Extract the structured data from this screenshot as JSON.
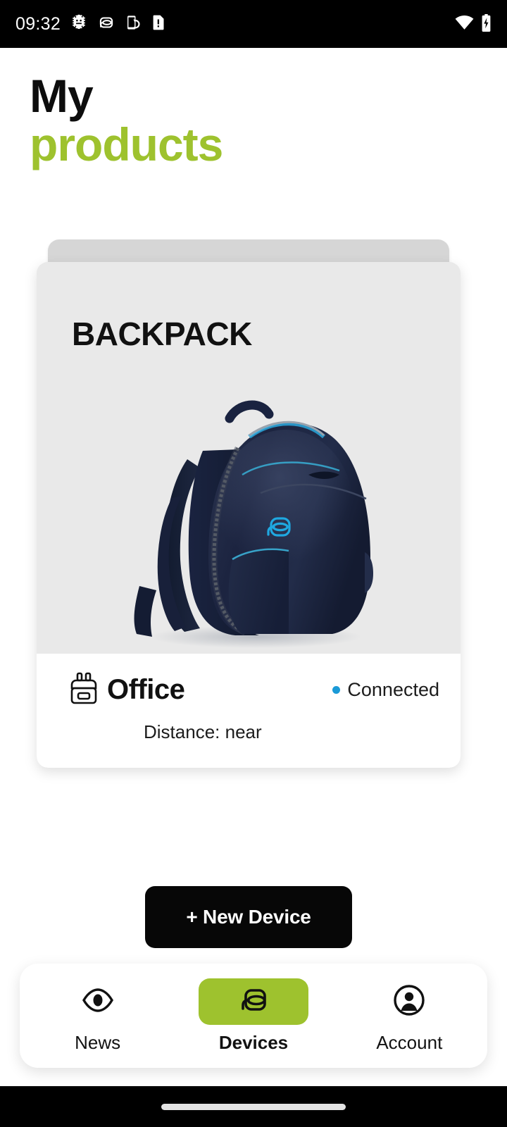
{
  "status_bar": {
    "time": "09:32",
    "left_icons": [
      "bug-gear-icon",
      "backpack-app-icon",
      "phone-sync-icon",
      "sd-card-alert-icon"
    ],
    "right_icons": [
      "wifi-icon",
      "battery-charging-icon"
    ],
    "background": "#000000",
    "foreground": "#ffffff"
  },
  "header": {
    "title_line1": "My",
    "title_line2": "products",
    "accent_color": "#9ec22e"
  },
  "product_card": {
    "category": "BACKPACK",
    "image_alt": "navy-blue-leather-backpack",
    "device_name": "Office",
    "device_icon": "backpack-icon",
    "status_label": "Connected",
    "status_color": "#1a9ad7",
    "distance_label": "Distance: near",
    "card_background": "#e9e9e9",
    "stack_background": "#d6d6d6",
    "footer_background": "#ffffff"
  },
  "actions": {
    "new_device_label": "+ New Device",
    "new_device_background": "#070707"
  },
  "bottom_nav": {
    "active_background": "#9ec22e",
    "items": [
      {
        "label": "News",
        "icon": "eye-icon",
        "active": false
      },
      {
        "label": "Devices",
        "icon": "bag-logo-icon",
        "active": true
      },
      {
        "label": "Account",
        "icon": "account-circle-icon",
        "active": false
      }
    ]
  },
  "system": {
    "gesture_bar_color": "#000000",
    "gesture_pill_color": "#e3e3e3"
  }
}
